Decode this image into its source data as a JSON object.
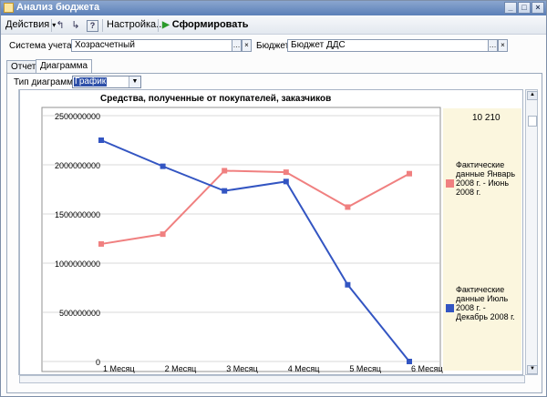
{
  "window": {
    "title": "Анализ бюджета",
    "buttons": [
      "_",
      "□",
      "×"
    ]
  },
  "toolbar": {
    "actions_label": "Действия",
    "settings_label": "Настройка...",
    "generate_label": "Сформировать"
  },
  "filters": {
    "accounting_label": "Система учета:",
    "accounting_value": "Хозрасчетный",
    "budget_label": "Бюджет:",
    "budget_value": "Бюджет ДДС"
  },
  "tabs": [
    {
      "label": "Отчет"
    },
    {
      "label": "Диаграмма"
    }
  ],
  "chart_type": {
    "label": "Тип диаграммы:",
    "value": "График"
  },
  "chart_data": {
    "type": "line",
    "title": "Средства, полученные от покупателей, заказчиков",
    "categories": [
      "1 Месяц",
      "2 Месяц",
      "3 Месяц",
      "4 Месяц",
      "5 Месяц",
      "6 Месяц"
    ],
    "ylim": [
      0,
      2500000000
    ],
    "yticks": [
      "2500000000",
      "2000000000",
      "1500000000",
      "1000000000",
      "500000000",
      "0"
    ],
    "legend_value": "10 210",
    "legend_position": "right",
    "grid": true,
    "series": [
      {
        "name": "Фактические данные Январь 2008 г. - Июнь 2008 г.",
        "color": "#f08080",
        "values": [
          1195000000,
          1295000000,
          1940000000,
          1925000000,
          1570000000,
          1910000000
        ]
      },
      {
        "name": "Фактические данные Июль 2008 г. - Декабрь 2008 г.",
        "color": "#3355c2",
        "values": [
          2250000000,
          1985000000,
          1735000000,
          1830000000,
          780000000,
          0
        ]
      }
    ]
  }
}
